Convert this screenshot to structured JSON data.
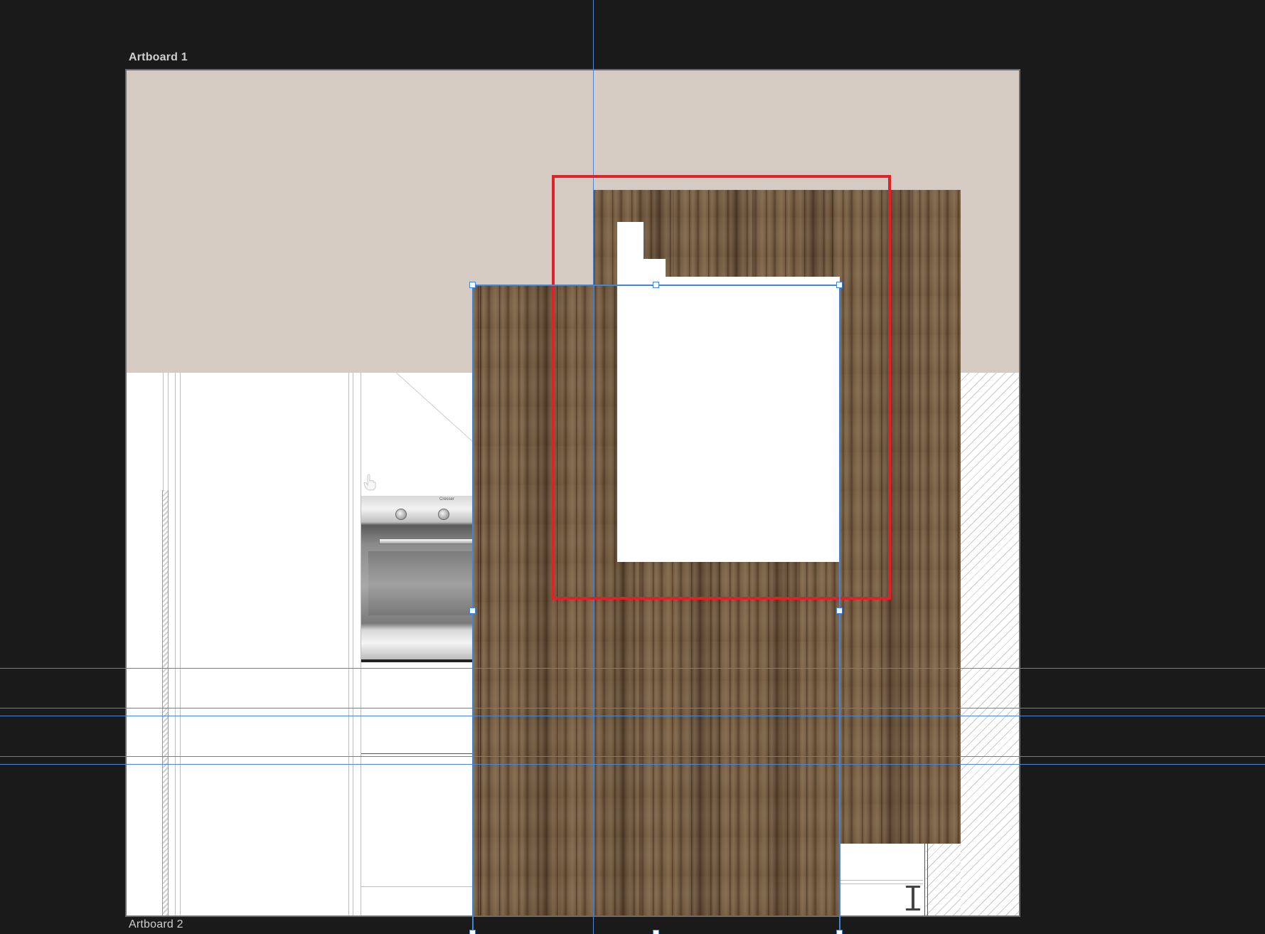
{
  "canvas": {
    "background": "#1a1a1b",
    "artboards": [
      {
        "label": "Artboard 1"
      },
      {
        "label": "Artboard 2"
      }
    ]
  },
  "scene": {
    "wall_color": "#d6cbc2",
    "wood_color": "#735a40",
    "appliance": {
      "brand": "Cresser",
      "icon": "oven-icon"
    }
  },
  "selection": {
    "guide_color": "#4a86d4",
    "handle_color": "#3f86d6",
    "highlight_color": "#e02127"
  },
  "cursor": {
    "icon": "hand-pointer-icon"
  }
}
